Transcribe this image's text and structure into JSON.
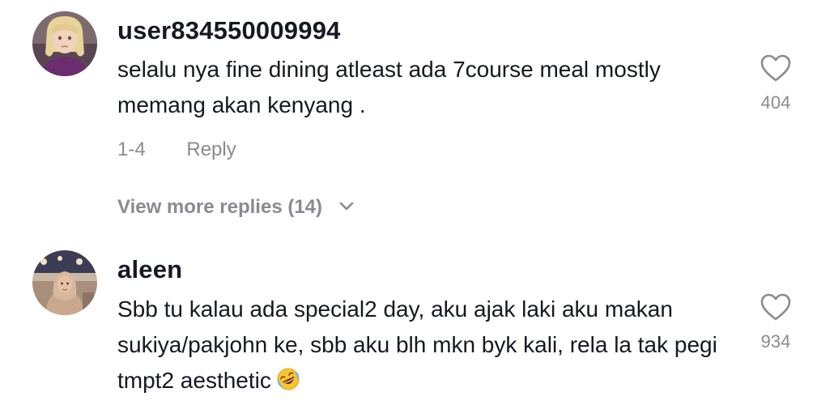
{
  "comments": [
    {
      "username": "user834550009994",
      "text": "selalu nya fine dining atleast ada 7course meal mostly memang akan kenyang .",
      "likes": "404",
      "date": "1-4",
      "reply_label": "Reply",
      "view_more_replies": "View more replies (14)",
      "avatar_icon": "avatar-girl-photo"
    },
    {
      "username": "aleen",
      "text": "Sbb tu kalau ada special2 day, aku ajak laki aku makan sukiya/pakjohn ke, sbb aku blh mkn byk kali, rela la tak pegi tmpt2 aesthetic",
      "emoji": "rolling-on-floor-laughing-emoji",
      "likes": "934",
      "avatar_icon": "avatar-woman-hijab-photo"
    }
  ],
  "colors": {
    "primary_text": "#161823",
    "secondary_text": "#8a8b91",
    "background": "#ffffff"
  },
  "icons": {
    "like": "heart-outline-icon",
    "expand": "chevron-down-icon"
  }
}
